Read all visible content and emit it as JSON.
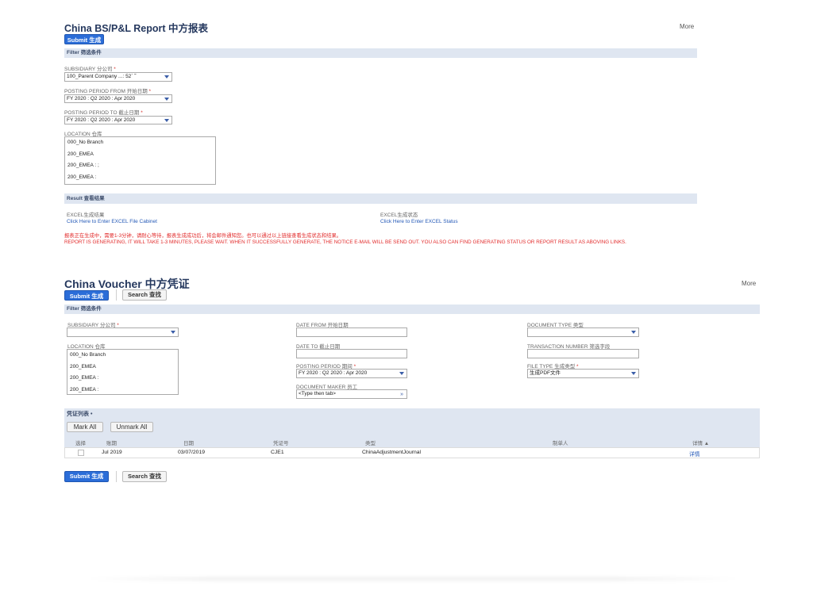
{
  "report": {
    "title": "China BS/P&L Report 中方报表",
    "more": "More",
    "submit": "Submit 生成",
    "filter_header": "Filter 筛选条件",
    "subsidiary_label": "SUBSIDIARY 分公司",
    "subsidiary_value": "100_Parent Company ...: 52`      ˜",
    "period_from_label": "POSTING PERIOD FROM 开始日期",
    "period_from_value": "FY 2020 : Q2 2020 : Apr 2020",
    "period_to_label": "POSTING PERIOD TO 截止日期",
    "period_to_value": "FY 2020 : Q2 2020 : Apr 2020",
    "location_label": "LOCATION 仓库",
    "locations": [
      "000_No Branch",
      "200_EMEA",
      "200_EMEA : ;",
      "200_EMEA :"
    ],
    "result_header": "Result 查看结果",
    "excel_result_label": "EXCEL生成结果",
    "excel_result_link": "Click Here to Enter EXCEL File Cabinet",
    "excel_status_label": "EXCEL生成状态",
    "excel_status_link": "Click Here to Enter EXCEL Status",
    "notice_cn": "报表正在生成中，需要1-3分钟，请耐心等待，报表生成成功后，将会邮件通知您。也可以通过以上链接查看生成状态和结果。",
    "notice_en": "REPORT IS GENERATING, IT WILL TAKE 1-3 MINUTES, PLEASE WAIT. WHEN IT SUCCESSFULLY GENERATE, THE NOTICE E-MAIL WILL BE SEND OUT. YOU ALSO CAN FIND GENERATING STATUS OR REPORT RESULT AS ABOVING LINKS."
  },
  "voucher": {
    "title": "China Voucher 中方凭证",
    "more": "More",
    "submit": "Submit 生成",
    "search": "Search 查找",
    "filter_header": "Filter 筛选条件",
    "subsidiary_label": "SUBSIDIARY 分公司",
    "subsidiary_value": "",
    "location_label": "LOCATION 仓库",
    "locations": [
      "000_No Branch",
      "200_EMEA",
      "200_EMEA :",
      "200_EMEA :"
    ],
    "date_from_label": "DATE FROM 开始日期",
    "date_to_label": "DATE TO 截止日期",
    "posting_period_label": "POSTING PERIOD 期间",
    "posting_period_value": "FY 2020 : Q2 2020 : Apr 2020",
    "doc_maker_label": "DOCUMENT MAKER 员工",
    "doc_maker_placeholder": "<Type then tab>",
    "doc_type_label": "DOCUMENT TYPE 类型",
    "doc_type_value": "",
    "txn_number_label": "TRANSACTION NUMBER 筛选字段",
    "file_type_label": "FILE TYPE 生成类型",
    "file_type_value": "生成PDF文件",
    "list_header": "凭证列表",
    "mark_all": "Mark All",
    "unmark_all": "Unmark All",
    "columns": [
      "选择",
      "账期",
      "日期",
      "凭证号",
      "类型",
      "制单人",
      "详情 ▲"
    ],
    "rows": [
      {
        "period": "Jul 2019",
        "date": "03/07/2019",
        "number": "CJE1",
        "type": "ChinaAdjustmentJournal",
        "maker": "",
        "detail": "详情"
      }
    ]
  },
  "colors": {
    "accent": "#2b6dd8",
    "band": "#dfe6f1",
    "title": "#25385e",
    "warning": "#e22b2b",
    "link": "#2459b7"
  }
}
